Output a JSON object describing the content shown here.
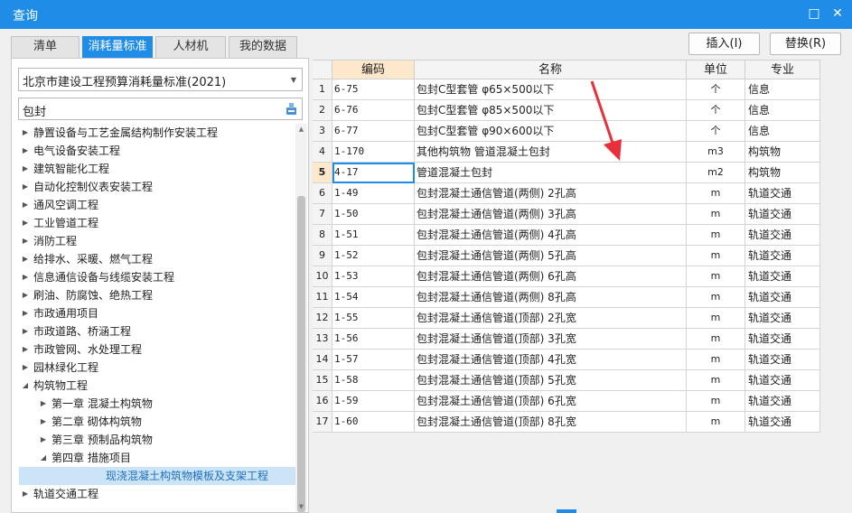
{
  "window": {
    "title": "查询",
    "restore_glyph": "□",
    "close_glyph": "✕"
  },
  "tabs": [
    {
      "label": "清单",
      "active": false
    },
    {
      "label": "消耗量标准",
      "active": true
    },
    {
      "label": "人材机",
      "active": false
    },
    {
      "label": "我的数据",
      "active": false
    }
  ],
  "toolbar": {
    "insert_label": "插入(I)",
    "replace_label": "替换(R)"
  },
  "left": {
    "standard_select": "北京市建设工程预算消耗量标准(2021)",
    "search_value": "包封",
    "tree": [
      {
        "label": "静置设备与工艺金属结构制作安装工程",
        "level": 0,
        "toggle": "▶"
      },
      {
        "label": "电气设备安装工程",
        "level": 0,
        "toggle": "▶"
      },
      {
        "label": "建筑智能化工程",
        "level": 0,
        "toggle": "▶"
      },
      {
        "label": "自动化控制仪表安装工程",
        "level": 0,
        "toggle": "▶"
      },
      {
        "label": "通风空调工程",
        "level": 0,
        "toggle": "▶"
      },
      {
        "label": "工业管道工程",
        "level": 0,
        "toggle": "▶"
      },
      {
        "label": "消防工程",
        "level": 0,
        "toggle": "▶"
      },
      {
        "label": "给排水、采暖、燃气工程",
        "level": 0,
        "toggle": "▶"
      },
      {
        "label": "信息通信设备与线缆安装工程",
        "level": 0,
        "toggle": "▶"
      },
      {
        "label": "刷油、防腐蚀、绝热工程",
        "level": 0,
        "toggle": "▶"
      },
      {
        "label": "市政通用项目",
        "level": 0,
        "toggle": "▶"
      },
      {
        "label": "市政道路、桥涵工程",
        "level": 0,
        "toggle": "▶"
      },
      {
        "label": "市政管网、水处理工程",
        "level": 0,
        "toggle": "▶"
      },
      {
        "label": "园林绿化工程",
        "level": 0,
        "toggle": "▶"
      },
      {
        "label": "构筑物工程",
        "level": 0,
        "toggle": "◢"
      },
      {
        "label": "第一章 混凝土构筑物",
        "level": 1,
        "toggle": "▶"
      },
      {
        "label": "第二章 砌体构筑物",
        "level": 1,
        "toggle": "▶"
      },
      {
        "label": "第三章 预制品构筑物",
        "level": 1,
        "toggle": "▶"
      },
      {
        "label": "第四章 措施项目",
        "level": 1,
        "toggle": "◢"
      },
      {
        "label": "现浇混凝土构筑物模板及支架工程",
        "level": 2,
        "toggle": "",
        "selected": true
      },
      {
        "label": "轨道交通工程",
        "level": 0,
        "toggle": "▶"
      }
    ]
  },
  "grid": {
    "columns": [
      "编码",
      "名称",
      "单位",
      "专业"
    ],
    "rows": [
      {
        "num": "1",
        "code": "6-75",
        "name": "包封C型套管 φ65×500以下",
        "unit": "个",
        "spec": "信息"
      },
      {
        "num": "2",
        "code": "6-76",
        "name": "包封C型套管 φ85×500以下",
        "unit": "个",
        "spec": "信息"
      },
      {
        "num": "3",
        "code": "6-77",
        "name": "包封C型套管 φ90×600以下",
        "unit": "个",
        "spec": "信息"
      },
      {
        "num": "4",
        "code": "1-170",
        "name": "其他构筑物 管道混凝土包封",
        "unit": "m3",
        "spec": "构筑物"
      },
      {
        "num": "5",
        "code": "4-17",
        "name": "管道混凝土包封",
        "unit": "m2",
        "spec": "构筑物",
        "current": true
      },
      {
        "num": "6",
        "code": "1-49",
        "name": "包封混凝土通信管道(两侧) 2孔高",
        "unit": "m",
        "spec": "轨道交通"
      },
      {
        "num": "7",
        "code": "1-50",
        "name": "包封混凝土通信管道(两侧) 3孔高",
        "unit": "m",
        "spec": "轨道交通"
      },
      {
        "num": "8",
        "code": "1-51",
        "name": "包封混凝土通信管道(两侧) 4孔高",
        "unit": "m",
        "spec": "轨道交通"
      },
      {
        "num": "9",
        "code": "1-52",
        "name": "包封混凝土通信管道(两侧) 5孔高",
        "unit": "m",
        "spec": "轨道交通"
      },
      {
        "num": "10",
        "code": "1-53",
        "name": "包封混凝土通信管道(两侧) 6孔高",
        "unit": "m",
        "spec": "轨道交通"
      },
      {
        "num": "11",
        "code": "1-54",
        "name": "包封混凝土通信管道(两侧) 8孔高",
        "unit": "m",
        "spec": "轨道交通"
      },
      {
        "num": "12",
        "code": "1-55",
        "name": "包封混凝土通信管道(顶部) 2孔宽",
        "unit": "m",
        "spec": "轨道交通"
      },
      {
        "num": "13",
        "code": "1-56",
        "name": "包封混凝土通信管道(顶部) 3孔宽",
        "unit": "m",
        "spec": "轨道交通"
      },
      {
        "num": "14",
        "code": "1-57",
        "name": "包封混凝土通信管道(顶部) 4孔宽",
        "unit": "m",
        "spec": "轨道交通"
      },
      {
        "num": "15",
        "code": "1-58",
        "name": "包封混凝土通信管道(顶部) 5孔宽",
        "unit": "m",
        "spec": "轨道交通"
      },
      {
        "num": "16",
        "code": "1-59",
        "name": "包封混凝土通信管道(顶部) 6孔宽",
        "unit": "m",
        "spec": "轨道交通"
      },
      {
        "num": "17",
        "code": "1-60",
        "name": "包封混凝土通信管道(顶部) 8孔宽",
        "unit": "m",
        "spec": "轨道交通"
      }
    ]
  },
  "colors": {
    "accent": "#1f8ce8",
    "annotation_arrow": "#e8303a",
    "header_highlight": "#fde8cc"
  }
}
